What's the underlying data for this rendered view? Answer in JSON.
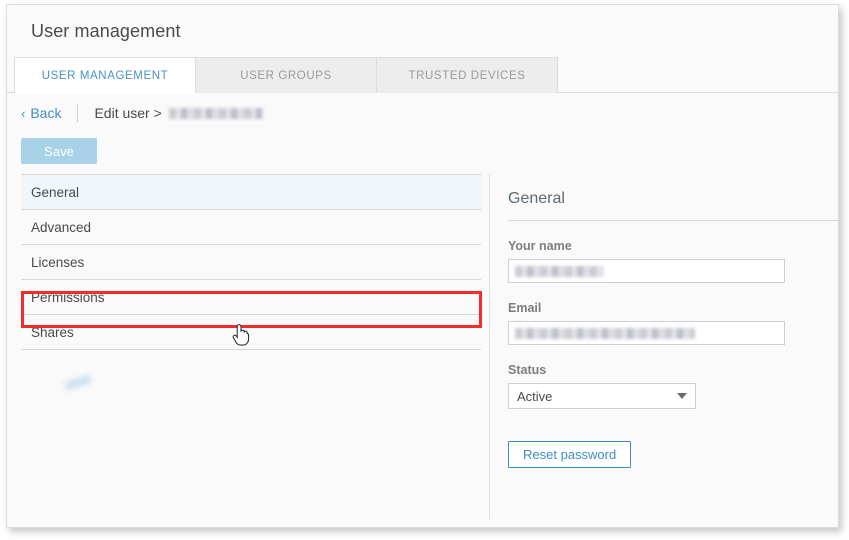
{
  "window": {
    "title": "User management"
  },
  "tabs": [
    {
      "label": "USER MANAGEMENT",
      "active": true
    },
    {
      "label": "USER GROUPS",
      "active": false
    },
    {
      "label": "TRUSTED DEVICES",
      "active": false
    }
  ],
  "breadcrumb": {
    "back_label": "Back",
    "chevron": "‹",
    "edit_label": "Edit user >",
    "user_name_redacted": ""
  },
  "toolbar": {
    "save_label": "Save"
  },
  "nav": {
    "items": [
      {
        "label": "General",
        "selected": true
      },
      {
        "label": "Advanced",
        "selected": false
      },
      {
        "label": "Licenses",
        "selected": false
      },
      {
        "label": "Permissions",
        "selected": false,
        "highlighted": true
      },
      {
        "label": "Shares",
        "selected": false
      }
    ]
  },
  "detail": {
    "heading": "General",
    "name_label": "Your name",
    "name_value_redacted": "",
    "email_label": "Email",
    "email_value_redacted": "",
    "status_label": "Status",
    "status_value": "Active",
    "status_options": [
      "Active"
    ],
    "reset_password_label": "Reset password"
  },
  "annotation": {
    "highlight_color": "#f22b2b",
    "target": "Permissions"
  },
  "colors": {
    "accent_blue": "#3f8ec0",
    "tab_active_text": "#4a90c4",
    "save_disabled": "#a8d2e8",
    "selected_row": "#eff7fd"
  }
}
